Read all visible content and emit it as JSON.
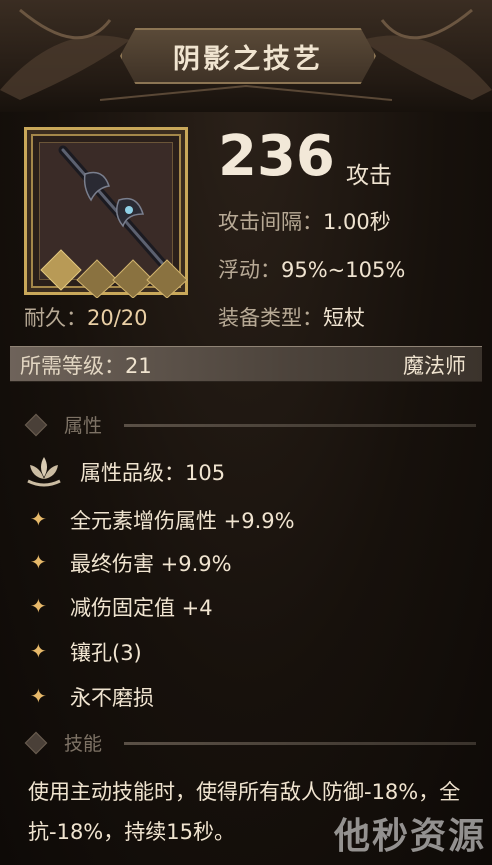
{
  "title": "阴影之技艺",
  "item": {
    "icon": "dark-staff-icon",
    "attack_value": "236",
    "attack_unit": "攻击",
    "stats": [
      {
        "label": "攻击间隔：",
        "value": "1.00秒"
      },
      {
        "label": "浮动：",
        "value": "95%~105%"
      },
      {
        "label": "装备类型：",
        "value": "短杖"
      }
    ],
    "durability_label": "耐久：",
    "durability_current": "20",
    "durability_max": "/20"
  },
  "requirement": {
    "label": "所需等级：",
    "level": "21",
    "class": "魔法师"
  },
  "attributes_section": {
    "heading": "属性",
    "grade_label": "属性品级：",
    "grade_value": "105",
    "items": [
      "全元素增伤属性 +9.9%",
      "最终伤害 +9.9%",
      "减伤固定值 +4",
      "镶孔(3)",
      "永不磨损"
    ]
  },
  "skill_section": {
    "heading": "技能",
    "description": "使用主动技能时，使得所有敌人防御-18%，全抗-18%，持续15秒。"
  },
  "watermark": "他秒资源",
  "colors": {
    "gold_border": "#c9a85a",
    "star": "#e7b96a",
    "text": "#f0e4d0",
    "muted": "#b7a995"
  }
}
